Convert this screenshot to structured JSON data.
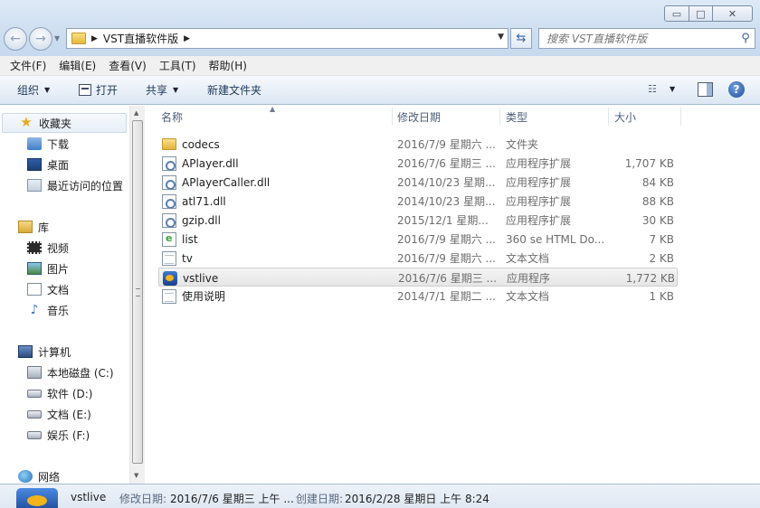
{
  "window": {
    "controls": {
      "minimize": "▭",
      "maximize": "□",
      "close": "✕"
    }
  },
  "address": {
    "breadcrumb": [
      "VST直播软件版"
    ],
    "search_placeholder": "搜索 VST直播软件版"
  },
  "menu": [
    "文件(F)",
    "编辑(E)",
    "查看(V)",
    "工具(T)",
    "帮助(H)"
  ],
  "toolbar": {
    "organize": "组织",
    "open": "打开",
    "share": "共享",
    "new_folder": "新建文件夹"
  },
  "sidebar": {
    "favorites": {
      "label": "收藏夹",
      "items": [
        "下载",
        "桌面",
        "最近访问的位置"
      ]
    },
    "libraries": {
      "label": "库",
      "items": [
        "视频",
        "图片",
        "文档",
        "音乐"
      ]
    },
    "computer": {
      "label": "计算机",
      "items": [
        "本地磁盘 (C:)",
        "软件 (D:)",
        "文档 (E:)",
        "娱乐 (F:)"
      ]
    },
    "network": {
      "label": "网络"
    }
  },
  "columns": {
    "name": "名称",
    "date": "修改日期",
    "type": "类型",
    "size": "大小"
  },
  "files": [
    {
      "name": "codecs",
      "date": "2016/7/9 星期六 ...",
      "type": "文件夹",
      "size": "",
      "icon": "folder-icon"
    },
    {
      "name": "APlayer.dll",
      "date": "2016/7/6 星期三 ...",
      "type": "应用程序扩展",
      "size": "1,707 KB",
      "icon": "dll-icon"
    },
    {
      "name": "APlayerCaller.dll",
      "date": "2014/10/23 星期...",
      "type": "应用程序扩展",
      "size": "84 KB",
      "icon": "dll-icon"
    },
    {
      "name": "atl71.dll",
      "date": "2014/10/23 星期...",
      "type": "应用程序扩展",
      "size": "88 KB",
      "icon": "dll-icon"
    },
    {
      "name": "gzip.dll",
      "date": "2015/12/1 星期...",
      "type": "应用程序扩展",
      "size": "30 KB",
      "icon": "dll-icon"
    },
    {
      "name": "list",
      "date": "2016/7/9 星期六 ...",
      "type": "360 se HTML Do...",
      "size": "7 KB",
      "icon": "html-file-icon"
    },
    {
      "name": "tv",
      "date": "2016/7/9 星期六 ...",
      "type": "文本文档",
      "size": "2 KB",
      "icon": "text-file-icon"
    },
    {
      "name": "vstlive",
      "date": "2016/7/6 星期三 ...",
      "type": "应用程序",
      "size": "1,772 KB",
      "icon": "exe-icon",
      "selected": true
    },
    {
      "name": "使用说明",
      "date": "2014/7/1 星期二 ...",
      "type": "文本文档",
      "size": "1 KB",
      "icon": "text-file-icon"
    }
  ],
  "details": {
    "name": "vstlive",
    "modified_label": "修改日期:",
    "modified_value": "2016/7/6 星期三 上午 ...",
    "created_label": "创建日期:",
    "created_value": "2016/2/28 星期日 上午 8:24"
  }
}
